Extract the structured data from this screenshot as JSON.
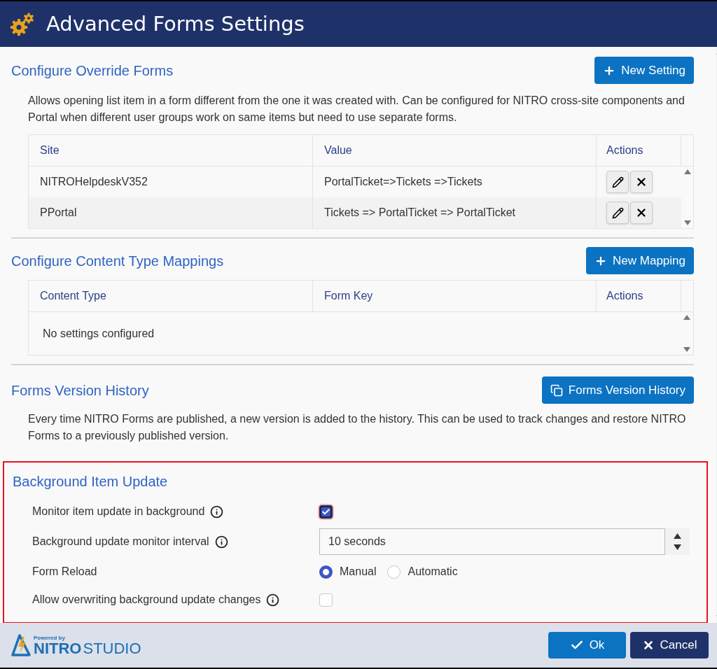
{
  "window": {
    "title": "Advanced Forms Settings"
  },
  "override_forms": {
    "title": "Configure Override Forms",
    "button": "New Setting",
    "description": "Allows opening list item in a form different from the one it was created with. Can be configured for NITRO cross-site components and Portal when different user groups work on same items but need to use separate forms.",
    "table": {
      "columns": [
        "Site",
        "Value",
        "Actions"
      ],
      "rows": [
        {
          "site": "NITROHelpdeskV352",
          "value": "PortalTicket=>Tickets =>Tickets"
        },
        {
          "site": "PPortal",
          "value": "Tickets => PortalTicket => PortalTicket"
        }
      ]
    }
  },
  "content_type_mappings": {
    "title": "Configure Content Type Mappings",
    "button": "New Mapping",
    "table": {
      "columns": [
        "Content Type",
        "Form Key",
        "Actions"
      ],
      "empty_message": "No settings configured"
    }
  },
  "version_history": {
    "title": "Forms Version History",
    "button": "Forms Version History",
    "description": "Every time NITRO Forms are published, a new version is added to the history. This can be used to track changes and restore NITRO Forms to a previously published version."
  },
  "background_update": {
    "title": "Background Item Update",
    "highlighted": true,
    "fields": [
      {
        "kind": "checkbox",
        "label": "Monitor item update in background",
        "info": true,
        "checked": true
      },
      {
        "kind": "spinner",
        "label": "Background update monitor interval",
        "info": true,
        "value": "10 seconds"
      },
      {
        "kind": "radio",
        "label": "Form Reload",
        "info": false,
        "options": [
          {
            "label": "Manual",
            "selected": true
          },
          {
            "label": "Automatic",
            "selected": false
          }
        ]
      },
      {
        "kind": "checkbox",
        "label": "Allow overwriting background update changes",
        "info": true,
        "checked": false
      }
    ]
  },
  "footer": {
    "logo_small": "Powered by",
    "logo_bold": "NITRO",
    "logo_light": "STUDIO",
    "buttons": [
      {
        "kind": "ok",
        "label": "Ok"
      },
      {
        "kind": "cancel",
        "label": "Cancel"
      }
    ]
  }
}
